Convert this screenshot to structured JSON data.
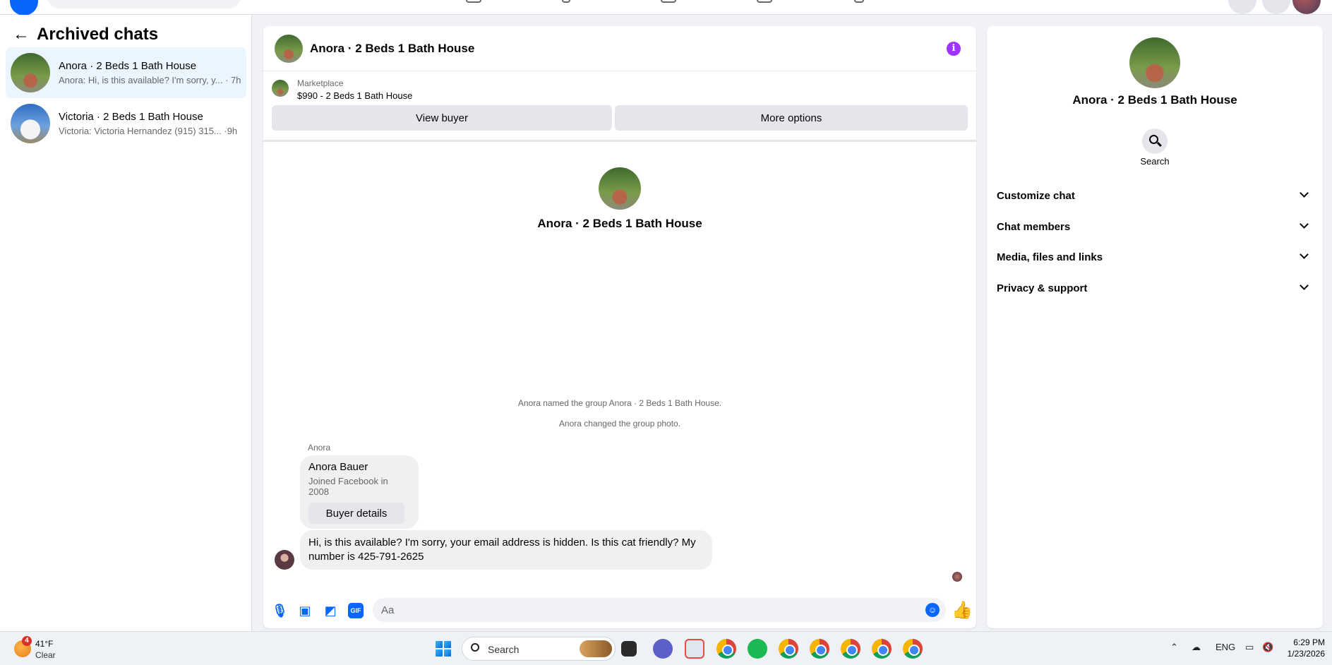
{
  "sidebar": {
    "title": "Archived chats",
    "chats": [
      {
        "name": "Anora · 2 Beds 1 Bath House",
        "preview": "Anora: Hi, is this available? I'm sorry, y... · 7h"
      },
      {
        "name": "Victoria · 2 Beds 1 Bath House",
        "preview": "Victoria: Victoria Hernandez (915) 315... ·9h"
      }
    ]
  },
  "chat": {
    "title": "Anora · 2 Beds 1 Bath House",
    "marketplace": {
      "label": "Marketplace",
      "listing": "$990 - 2 Beds 1 Bath House",
      "view_buyer": "View buyer",
      "more_options": "More options"
    },
    "intro_name": "Anora · 2 Beds 1 Bath House",
    "system_messages": [
      "Anora named the group Anora · 2 Beds 1 Bath House.",
      "Anora changed the group photo."
    ],
    "sender": "Anora",
    "buyer_card": {
      "name": "Anora Bauer",
      "joined": "Joined Facebook in 2008",
      "button": "Buyer details"
    },
    "message": "Hi, is this available? I'm sorry, your email address is hidden. Is this cat friendly? My number is 425-791-2625",
    "composer_placeholder": "Aa",
    "composer_icons": [
      "microphone-icon",
      "photo-icon",
      "sticker-icon",
      "gif-icon",
      "emoji-icon",
      "thumbs-up-icon"
    ],
    "gif_label": "GIF"
  },
  "right_panel": {
    "name": "Anora · 2 Beds 1 Bath House",
    "search_label": "Search",
    "sections": [
      "Customize chat",
      "Chat members",
      "Media, files and links",
      "Privacy & support"
    ]
  },
  "taskbar": {
    "weather_badge": "4",
    "temperature": "41°F",
    "condition": "Clear",
    "search_text": "Search",
    "lang": "ENG",
    "time": "6:29 PM",
    "date": "1/23/2026"
  },
  "colors": {
    "accent": "#0866ff",
    "info": "#a033ff",
    "active_chat_bg": "#ebf5ff"
  }
}
